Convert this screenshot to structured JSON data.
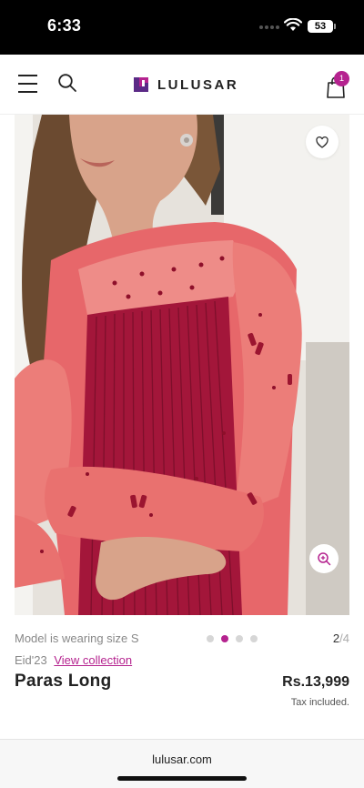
{
  "status_bar": {
    "time": "6:33",
    "battery": "53"
  },
  "header": {
    "brand": "LULUSAR",
    "cart_count": "1"
  },
  "product": {
    "model_note": "Model is wearing size S",
    "gallery": {
      "current": "2",
      "separator": "/",
      "total": "4",
      "active_dot": 2,
      "dot_count": 4
    },
    "collection_tag": "Eid'23",
    "collection_link": "View collection",
    "name": "Paras Long",
    "price": "Rs.13,999",
    "tax_note": "Tax included."
  },
  "browser": {
    "url": "lulusar.com"
  },
  "colors": {
    "accent": "#b5238f",
    "garment": "#d9534f",
    "pleat": "#a3163a"
  },
  "icons": [
    "menu-icon",
    "search-icon",
    "logo-icon",
    "cart-icon",
    "heart-icon",
    "zoom-in-icon",
    "wifi-icon"
  ]
}
